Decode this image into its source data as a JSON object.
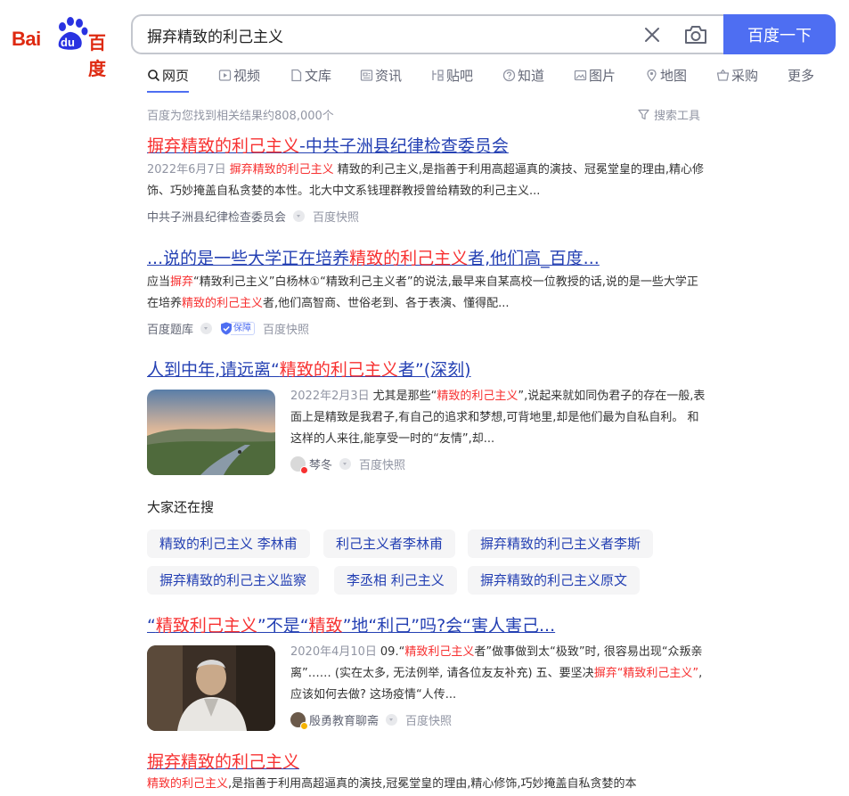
{
  "logo": {
    "latin": "Bai",
    "badge": "du",
    "chinese": "百度"
  },
  "search": {
    "query": "摒弃精致的利己主义",
    "button_label": "百度一下"
  },
  "tabs": [
    {
      "label": "网页",
      "icon": "search-icon",
      "active": true
    },
    {
      "label": "视频",
      "icon": "video-icon"
    },
    {
      "label": "文库",
      "icon": "document-icon"
    },
    {
      "label": "资讯",
      "icon": "news-icon"
    },
    {
      "label": "贴吧",
      "icon": "tieba-icon"
    },
    {
      "label": "知道",
      "icon": "question-icon"
    },
    {
      "label": "图片",
      "icon": "image-icon"
    },
    {
      "label": "地图",
      "icon": "map-pin-icon"
    },
    {
      "label": "采购",
      "icon": "shopping-basket-icon"
    },
    {
      "label": "更多"
    }
  ],
  "result_count": "百度为您找到相关结果约808,000个",
  "tools_label": "搜索工具",
  "results": [
    {
      "title_em": "摒弃精致的利己主义",
      "title_rest": "-中共子洲县纪律检查委员会",
      "date": "2022年6月7日",
      "snippet_em": "摒弃精致的利己主义",
      "snippet": "精致的利己主义,是指善于利用高超逼真的演技、冠冕堂皇的理由,精心修饰、巧妙掩盖自私贪婪的本性。北大中文系钱理群教授曾给精致的利己主义...",
      "source": "中共子洲县纪律检查委员会",
      "snapshot": "百度快照"
    },
    {
      "title_pre": "...说的是一些大学正在培养",
      "title_em": "精致的利己主义",
      "title_rest": "者,他们高_百度...",
      "snippet_a": "应当",
      "snippet_em1": "摒弃",
      "snippet_b": "“精致利己主义”白杨林①“精致利己主义者”的说法,最早来自某高校一位教授的话,说的是一些大学正在培养",
      "snippet_em2": "精致的利己主义",
      "snippet_c": "者,他们高智商、世俗老到、各于表演、懂得配...",
      "source": "百度题库",
      "badge": "保障",
      "snapshot": "百度快照"
    },
    {
      "title_pre": "人到中年,请远离“",
      "title_em": "精致的利己主义",
      "title_rest": "者”(深刻)",
      "date": "2022年2月3日",
      "snippet_a": "尤其是那些“",
      "snippet_em": "精致的利己主义",
      "snippet_b": "”,说起来就如同伪君子的存在一般,表面上是精致是我君子,有自己的追求和梦想,可背地里,却是他们最为自私自利。 和这样的人来往,能享受一时的“友情”,却...",
      "author": "棽冬",
      "snapshot": "百度快照"
    },
    {
      "title_a": "“",
      "title_em1": "精致利己主义",
      "title_b": "”不是“",
      "title_em2": "精致",
      "title_c": "”地“利己”吗?会“害人害己...",
      "date": "2020年4月10日",
      "snippet_a": "09.“",
      "snippet_em1": "精致利己主义",
      "snippet_b": "者”做事做到太“极致”时, 很容易出现“众叛亲离”…… (实在太多, 无法例举, 请各位友友补充) 五、要坚决",
      "snippet_em2": "摒弃“精致利己主义”",
      "snippet_c": ", 应该如何去做? 这场疫情“人传...",
      "author": "殷勇教育聊斋",
      "snapshot": "百度快照"
    },
    {
      "title_em": "摒弃精致的利己主义",
      "snippet_em": "精致的利己主义",
      "snippet": ",是指善于利用高超逼真的演技,冠冕堂皇的理由,精心修饰,巧妙掩盖自私贪婪的本"
    }
  ],
  "also_search": {
    "title": "大家还在搜",
    "items": [
      "精致的利己主义 李林甫",
      "利己主义者李林甫",
      "摒弃精致的利己主义者李斯",
      "摒弃精致的利己主义监察",
      "李丞相 利己主义",
      "摒弃精致的利己主义原文"
    ]
  },
  "colors": {
    "accent": "#4e6ef2",
    "link": "#2440b3",
    "highlight": "#f73131",
    "logo_red": "#de2910",
    "logo_blue": "#2932e1"
  }
}
